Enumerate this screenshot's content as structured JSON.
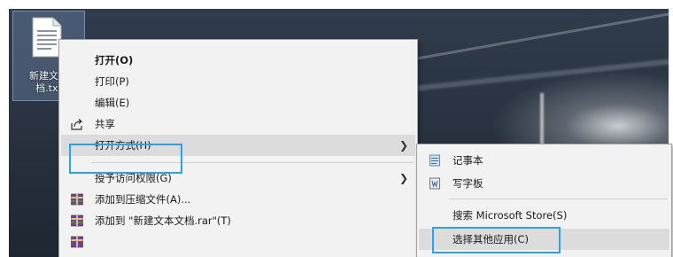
{
  "desktop": {
    "file_label_line1": "新建文本",
    "file_label_line2": "档.txt"
  },
  "context_menu": {
    "items": [
      {
        "label": "打开(O)"
      },
      {
        "label": "打印(P)"
      },
      {
        "label": "编辑(E)"
      },
      {
        "label": "共享"
      },
      {
        "label": "打开方式(H)"
      },
      {
        "label": "授予访问权限(G)"
      },
      {
        "label": "添加到压缩文件(A)..."
      },
      {
        "label": "添加到 \"新建文本文档.rar\"(T)"
      }
    ]
  },
  "open_with_submenu": {
    "items": [
      {
        "label": "记事本"
      },
      {
        "label": "写字板"
      },
      {
        "label": "搜索 Microsoft Store(S)"
      },
      {
        "label": "选择其他应用(C)"
      }
    ]
  },
  "colors": {
    "highlight_border": "#29a3e6",
    "menu_background": "#f2f2f2",
    "hover_background": "#dcdcdc"
  }
}
